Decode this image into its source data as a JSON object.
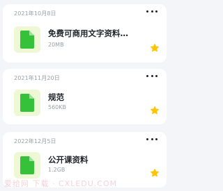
{
  "files": [
    {
      "date": "2021年10月8日",
      "title": "免费可商用文字资料…",
      "size": "20MB",
      "favorite": true
    },
    {
      "date": "2021年11月20日",
      "title": "规范",
      "size": "560KB",
      "favorite": true
    },
    {
      "date": "2022年12月5日",
      "title": "公开课资料",
      "size": "1.2GB",
      "favorite": true
    }
  ],
  "icons": {
    "file": "document-icon",
    "more": "more-dots-icon",
    "star": "star-icon"
  },
  "colors": {
    "file_icon_bg": "#eef8d4",
    "file_icon_fg": "#35c23a",
    "star": "#ffc400"
  },
  "watermark": "爱给网 下载 · CXLEDU.COM"
}
